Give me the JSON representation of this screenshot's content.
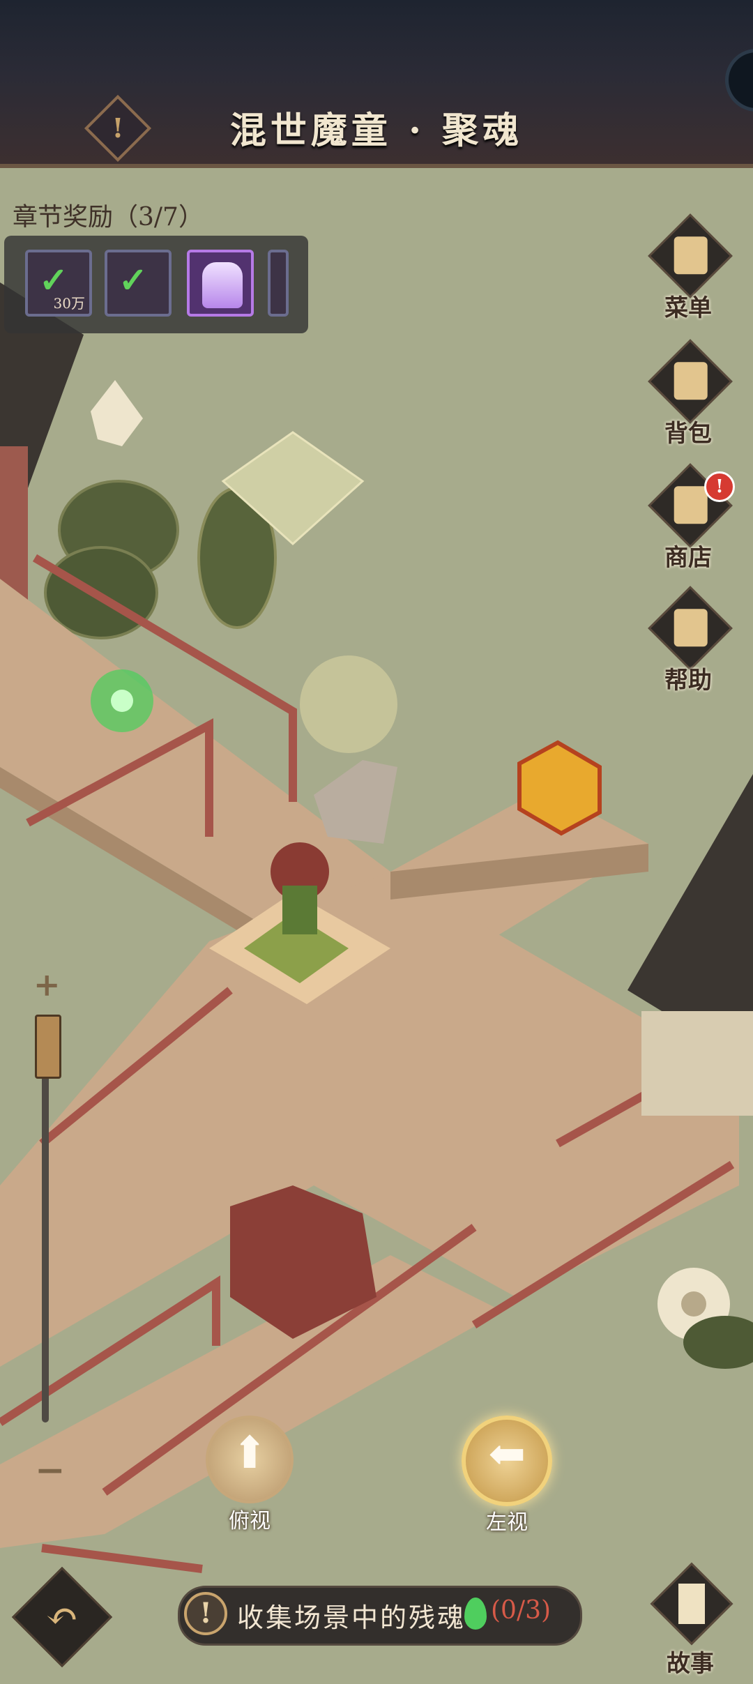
{
  "header": {
    "title": "混世魔童 · 聚魂"
  },
  "chapter_reward": {
    "label": "章节奖励（3/7）",
    "items": [
      {
        "icon": "coin-pouch-icon",
        "qty": "30万",
        "claimed": true
      },
      {
        "icon": "armor-chest-icon",
        "claimed": true
      },
      {
        "icon": "purple-robe-icon",
        "claimed": false
      }
    ]
  },
  "menu": {
    "items": [
      {
        "label": "菜单",
        "icon": "scroll-menu-icon"
      },
      {
        "label": "背包",
        "icon": "bag-icon"
      },
      {
        "label": "商店",
        "icon": "shop-icon",
        "badge": "!"
      },
      {
        "label": "帮助",
        "icon": "help-scroll-icon"
      }
    ]
  },
  "view_controls": {
    "top_view": "俯视",
    "left_view": "左视"
  },
  "quest": {
    "icon": "!",
    "text": "收集场景中的残魂",
    "progress": "(0/3)"
  },
  "story": {
    "label": "故事"
  },
  "colors": {
    "background": "#a7ab8c",
    "header": "#2b2b36",
    "walkway": "#c9a98a",
    "railing": "#a6554a",
    "soul_green": "#4fce5e",
    "progress_red": "#d75a48"
  }
}
